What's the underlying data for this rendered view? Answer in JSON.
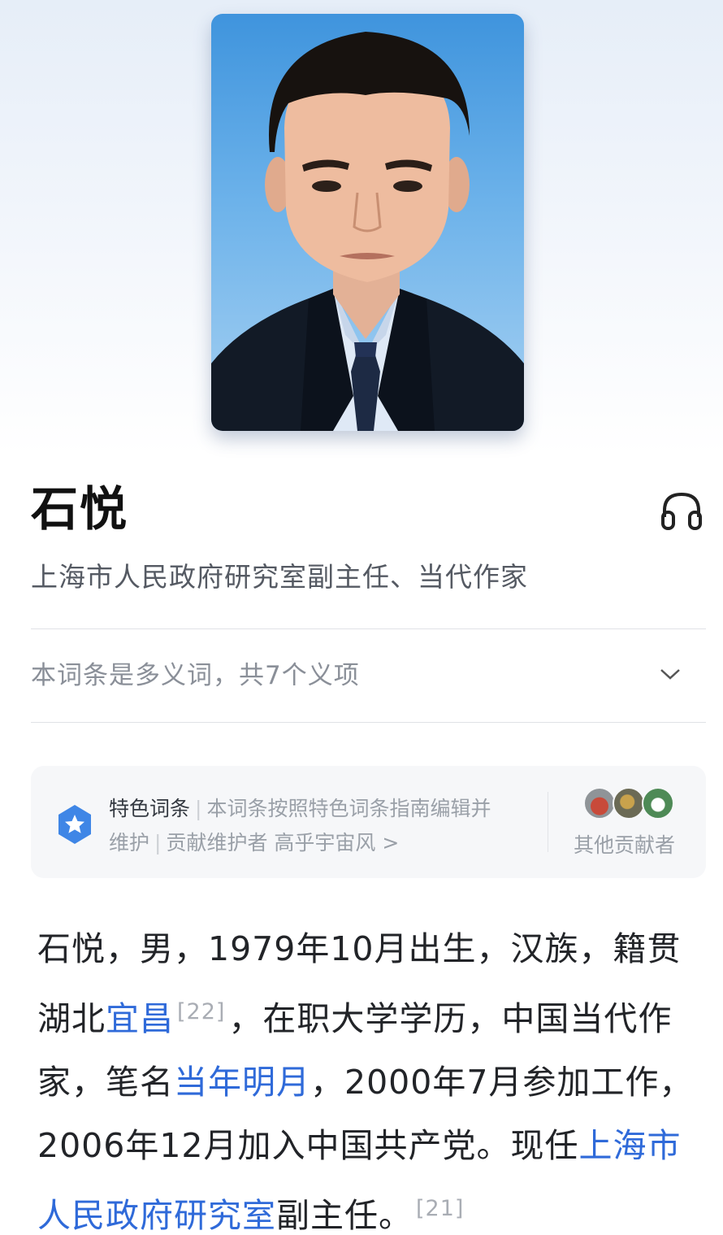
{
  "entry": {
    "title": "石悦",
    "subtitle": "上海市人民政府研究室副主任、当代作家",
    "audio_icon": "headphones-icon"
  },
  "polysemy": {
    "text": "本词条是多义词，共7个义项",
    "icon": "chevron-down-icon"
  },
  "feature": {
    "label": "特色词条",
    "sep": "|",
    "desc_part1": "本词条按照特色词条指南编辑并",
    "desc_part2": "维护",
    "contributor_prefix": "贡献维护者",
    "contributor_name": "高乎宇宙风",
    "arrow": ">",
    "others_label": "其他贡献者",
    "badge_icon": "featured-star-badge-icon"
  },
  "body": {
    "t1": "石悦，男，1979年10月出生，汉族，籍贯湖北",
    "link1": "宜昌",
    "ref1": "[22]",
    "t2": "，在职大学学历，中国当代作家，笔名",
    "link2": "当年明月",
    "t3": "，2000年7月参加工作，2006年12月加入中国共产党。现任",
    "link3": "上海市人民政府研究室",
    "t4": "副主任。",
    "ref2": "[21]"
  },
  "colors": {
    "link": "#2f6ad9",
    "badge": "#3f86e6",
    "portrait_bg": "#4a9ae0"
  }
}
